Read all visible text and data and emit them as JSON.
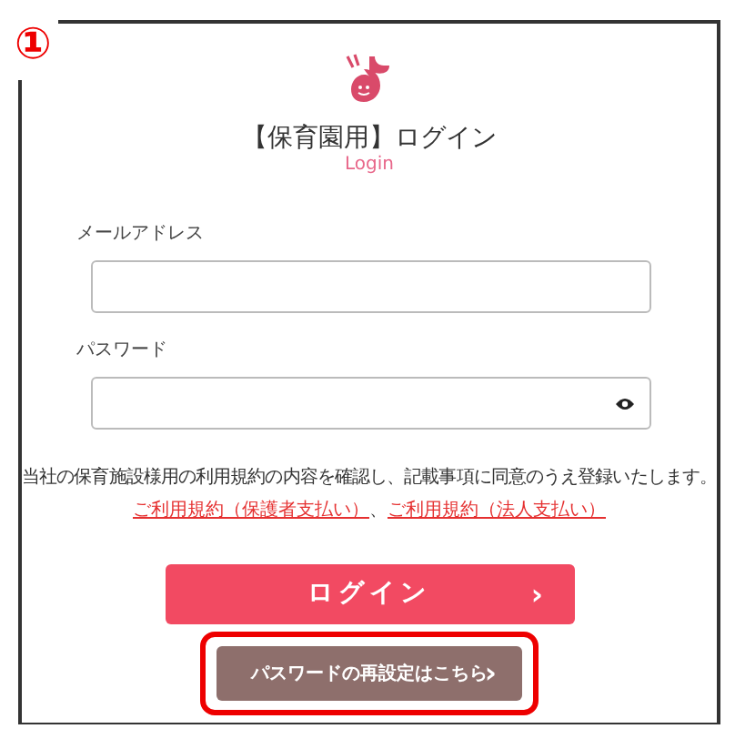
{
  "step_marker": "①",
  "header": {
    "title": "【保育園用】ログイン",
    "subtitle": "Login"
  },
  "fields": [
    {
      "label": "メールアドレス",
      "kind": "text"
    },
    {
      "label": "パスワード",
      "kind": "password"
    }
  ],
  "terms": {
    "text": "当社の保育施設様用の利用規約の内容を確認し、記載事項に同意のうえ登録いたします。",
    "links": [
      "ご利用規約（保護者支払い）",
      "ご利用規約（法人支払い）"
    ],
    "separator": "、"
  },
  "login_button": {
    "label": "ログイン",
    "chevron": "›"
  },
  "reset_button": {
    "label": "パスワードの再設定はこちら",
    "chevron": "›",
    "highlighted": true
  }
}
